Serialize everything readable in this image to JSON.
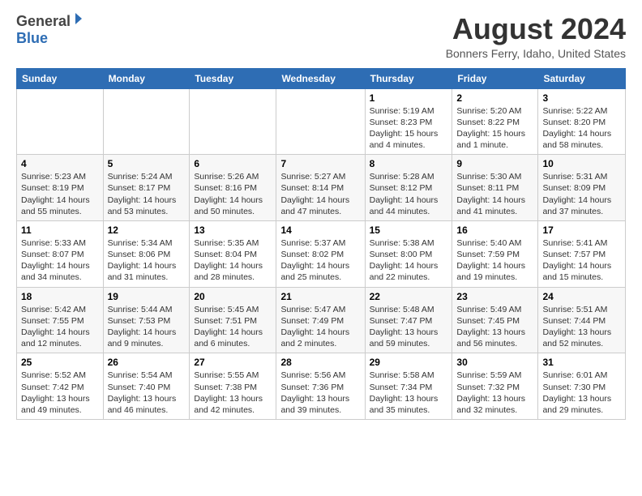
{
  "header": {
    "logo_general": "General",
    "logo_blue": "Blue",
    "month_title": "August 2024",
    "location": "Bonners Ferry, Idaho, United States"
  },
  "days_of_week": [
    "Sunday",
    "Monday",
    "Tuesday",
    "Wednesday",
    "Thursday",
    "Friday",
    "Saturday"
  ],
  "weeks": [
    [
      {
        "day": "",
        "info": ""
      },
      {
        "day": "",
        "info": ""
      },
      {
        "day": "",
        "info": ""
      },
      {
        "day": "",
        "info": ""
      },
      {
        "day": "1",
        "info": "Sunrise: 5:19 AM\nSunset: 8:23 PM\nDaylight: 15 hours\nand 4 minutes."
      },
      {
        "day": "2",
        "info": "Sunrise: 5:20 AM\nSunset: 8:22 PM\nDaylight: 15 hours\nand 1 minute."
      },
      {
        "day": "3",
        "info": "Sunrise: 5:22 AM\nSunset: 8:20 PM\nDaylight: 14 hours\nand 58 minutes."
      }
    ],
    [
      {
        "day": "4",
        "info": "Sunrise: 5:23 AM\nSunset: 8:19 PM\nDaylight: 14 hours\nand 55 minutes."
      },
      {
        "day": "5",
        "info": "Sunrise: 5:24 AM\nSunset: 8:17 PM\nDaylight: 14 hours\nand 53 minutes."
      },
      {
        "day": "6",
        "info": "Sunrise: 5:26 AM\nSunset: 8:16 PM\nDaylight: 14 hours\nand 50 minutes."
      },
      {
        "day": "7",
        "info": "Sunrise: 5:27 AM\nSunset: 8:14 PM\nDaylight: 14 hours\nand 47 minutes."
      },
      {
        "day": "8",
        "info": "Sunrise: 5:28 AM\nSunset: 8:12 PM\nDaylight: 14 hours\nand 44 minutes."
      },
      {
        "day": "9",
        "info": "Sunrise: 5:30 AM\nSunset: 8:11 PM\nDaylight: 14 hours\nand 41 minutes."
      },
      {
        "day": "10",
        "info": "Sunrise: 5:31 AM\nSunset: 8:09 PM\nDaylight: 14 hours\nand 37 minutes."
      }
    ],
    [
      {
        "day": "11",
        "info": "Sunrise: 5:33 AM\nSunset: 8:07 PM\nDaylight: 14 hours\nand 34 minutes."
      },
      {
        "day": "12",
        "info": "Sunrise: 5:34 AM\nSunset: 8:06 PM\nDaylight: 14 hours\nand 31 minutes."
      },
      {
        "day": "13",
        "info": "Sunrise: 5:35 AM\nSunset: 8:04 PM\nDaylight: 14 hours\nand 28 minutes."
      },
      {
        "day": "14",
        "info": "Sunrise: 5:37 AM\nSunset: 8:02 PM\nDaylight: 14 hours\nand 25 minutes."
      },
      {
        "day": "15",
        "info": "Sunrise: 5:38 AM\nSunset: 8:00 PM\nDaylight: 14 hours\nand 22 minutes."
      },
      {
        "day": "16",
        "info": "Sunrise: 5:40 AM\nSunset: 7:59 PM\nDaylight: 14 hours\nand 19 minutes."
      },
      {
        "day": "17",
        "info": "Sunrise: 5:41 AM\nSunset: 7:57 PM\nDaylight: 14 hours\nand 15 minutes."
      }
    ],
    [
      {
        "day": "18",
        "info": "Sunrise: 5:42 AM\nSunset: 7:55 PM\nDaylight: 14 hours\nand 12 minutes."
      },
      {
        "day": "19",
        "info": "Sunrise: 5:44 AM\nSunset: 7:53 PM\nDaylight: 14 hours\nand 9 minutes."
      },
      {
        "day": "20",
        "info": "Sunrise: 5:45 AM\nSunset: 7:51 PM\nDaylight: 14 hours\nand 6 minutes."
      },
      {
        "day": "21",
        "info": "Sunrise: 5:47 AM\nSunset: 7:49 PM\nDaylight: 14 hours\nand 2 minutes."
      },
      {
        "day": "22",
        "info": "Sunrise: 5:48 AM\nSunset: 7:47 PM\nDaylight: 13 hours\nand 59 minutes."
      },
      {
        "day": "23",
        "info": "Sunrise: 5:49 AM\nSunset: 7:45 PM\nDaylight: 13 hours\nand 56 minutes."
      },
      {
        "day": "24",
        "info": "Sunrise: 5:51 AM\nSunset: 7:44 PM\nDaylight: 13 hours\nand 52 minutes."
      }
    ],
    [
      {
        "day": "25",
        "info": "Sunrise: 5:52 AM\nSunset: 7:42 PM\nDaylight: 13 hours\nand 49 minutes."
      },
      {
        "day": "26",
        "info": "Sunrise: 5:54 AM\nSunset: 7:40 PM\nDaylight: 13 hours\nand 46 minutes."
      },
      {
        "day": "27",
        "info": "Sunrise: 5:55 AM\nSunset: 7:38 PM\nDaylight: 13 hours\nand 42 minutes."
      },
      {
        "day": "28",
        "info": "Sunrise: 5:56 AM\nSunset: 7:36 PM\nDaylight: 13 hours\nand 39 minutes."
      },
      {
        "day": "29",
        "info": "Sunrise: 5:58 AM\nSunset: 7:34 PM\nDaylight: 13 hours\nand 35 minutes."
      },
      {
        "day": "30",
        "info": "Sunrise: 5:59 AM\nSunset: 7:32 PM\nDaylight: 13 hours\nand 32 minutes."
      },
      {
        "day": "31",
        "info": "Sunrise: 6:01 AM\nSunset: 7:30 PM\nDaylight: 13 hours\nand 29 minutes."
      }
    ]
  ]
}
